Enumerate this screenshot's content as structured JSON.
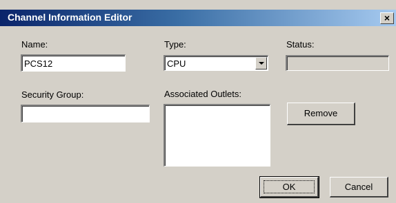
{
  "window": {
    "title": "Channel Information Editor",
    "close_label": "×"
  },
  "form": {
    "name_label": "Name:",
    "name_value": "PCS12",
    "type_label": "Type:",
    "type_value": "CPU",
    "status_label": "Status:",
    "status_value": "",
    "security_group_label": "Security Group:",
    "security_group_value": "",
    "associated_outlets_label": "Associated Outlets:",
    "associated_outlets_items": []
  },
  "buttons": {
    "remove_label": "Remove",
    "ok_label": "OK",
    "cancel_label": "Cancel"
  }
}
